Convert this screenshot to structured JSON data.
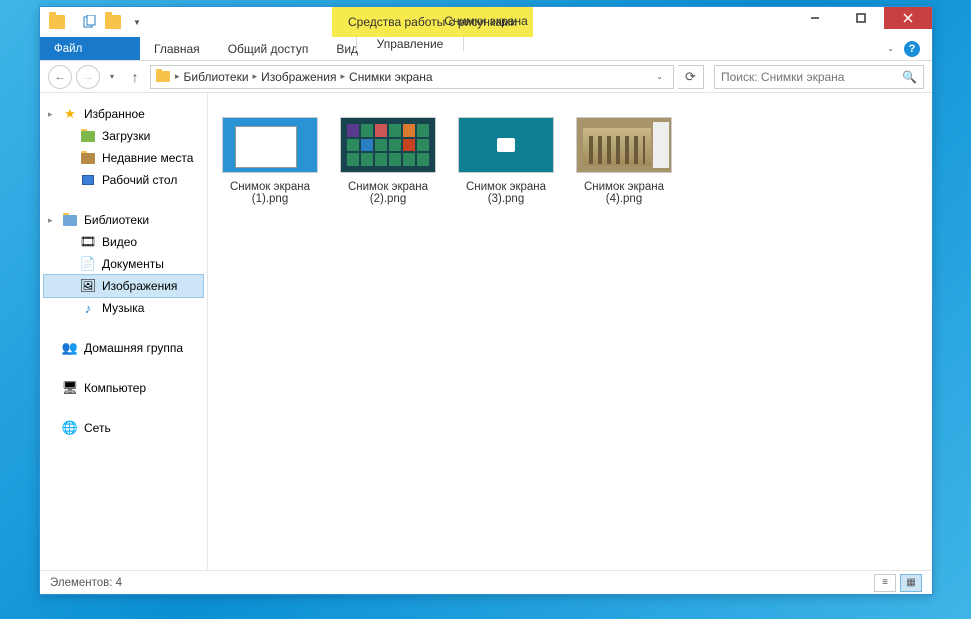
{
  "window": {
    "title": "Снимки экрана",
    "context_tab_title": "Средства работы с рисунками"
  },
  "ribbon": {
    "file": "Файл",
    "tabs": [
      "Главная",
      "Общий доступ",
      "Вид"
    ],
    "context_tab": "Управление"
  },
  "breadcrumb": {
    "items": [
      "Библиотеки",
      "Изображения",
      "Снимки экрана"
    ]
  },
  "search": {
    "placeholder": "Поиск: Снимки экрана"
  },
  "nav": {
    "favorites": {
      "label": "Избранное",
      "items": [
        "Загрузки",
        "Недавние места",
        "Рабочий стол"
      ]
    },
    "libraries": {
      "label": "Библиотеки",
      "items": [
        "Видео",
        "Документы",
        "Изображения",
        "Музыка"
      ],
      "selected_index": 2
    },
    "homegroup": {
      "label": "Домашняя группа"
    },
    "computer": {
      "label": "Компьютер"
    },
    "network": {
      "label": "Сеть"
    }
  },
  "files": [
    {
      "name_line1": "Снимок экрана",
      "name_line2": "(1).png"
    },
    {
      "name_line1": "Снимок экрана",
      "name_line2": "(2).png"
    },
    {
      "name_line1": "Снимок экрана",
      "name_line2": "(3).png"
    },
    {
      "name_line1": "Снимок экрана",
      "name_line2": "(4).png"
    }
  ],
  "status": {
    "count_label": "Элементов: 4"
  }
}
